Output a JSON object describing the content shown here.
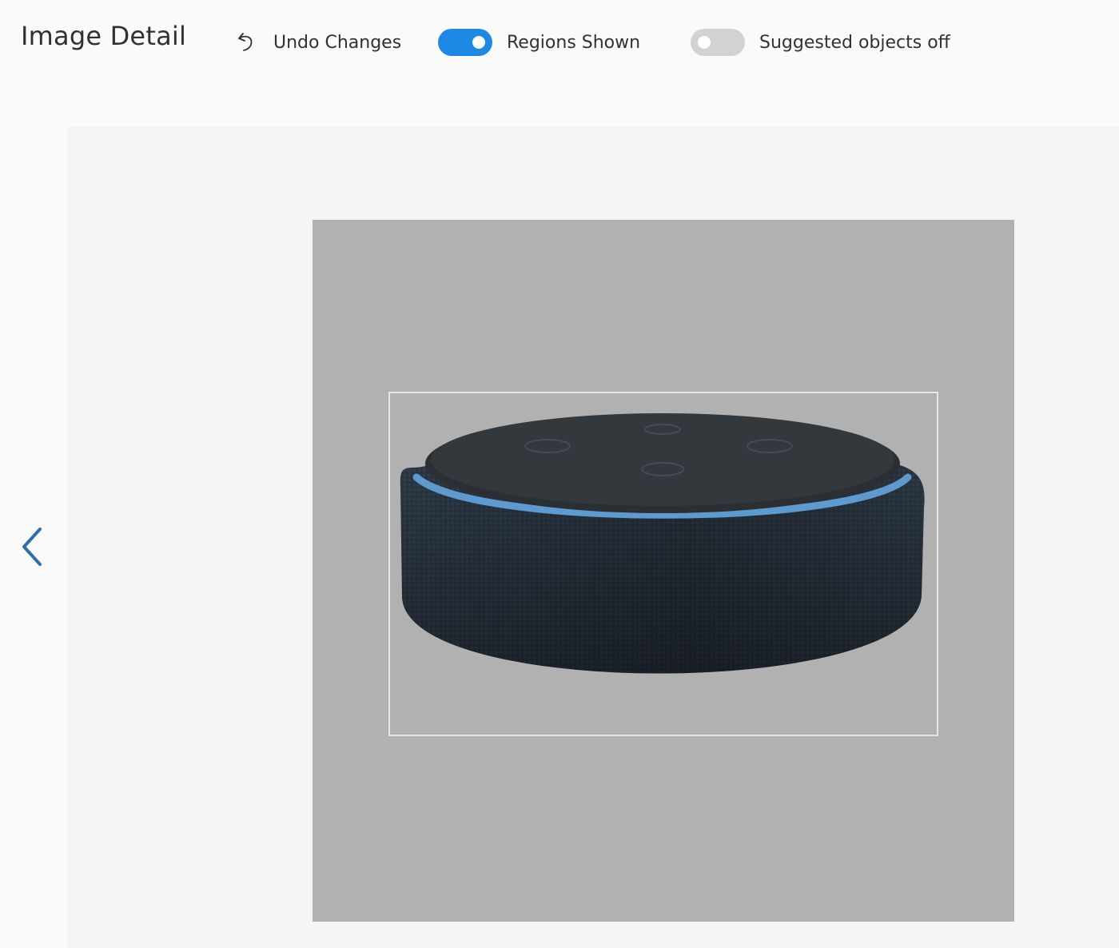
{
  "header": {
    "title": "Image Detail",
    "undo": {
      "label": "Undo Changes",
      "icon": "undo-icon"
    },
    "toggles": [
      {
        "label": "Regions Shown",
        "state": "on"
      },
      {
        "label": "Suggested objects off",
        "state": "off"
      }
    ]
  },
  "navigation": {
    "prev_icon": "chevron-left-icon"
  },
  "image": {
    "subject": "smart speaker",
    "region_count": 1
  },
  "colors": {
    "accent": "#1e88e5",
    "toggle_off": "#d2d2d2",
    "image_background": "#b1b1b1",
    "region_border": "#e6e6e6",
    "nav_arrow": "#2f6fb0"
  }
}
